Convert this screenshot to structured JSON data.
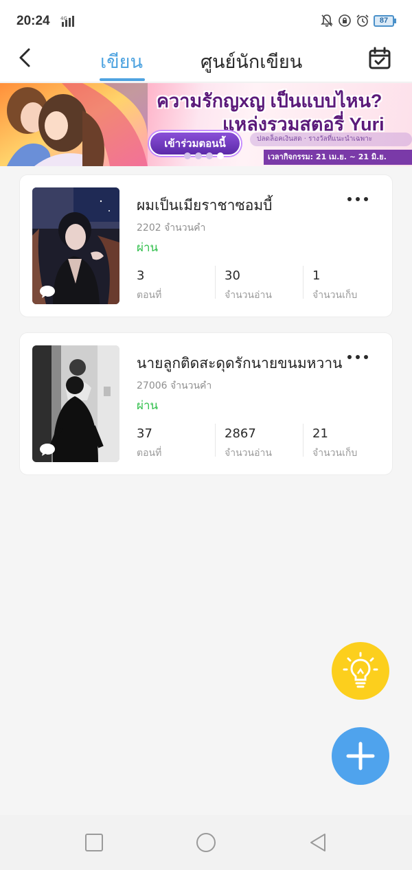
{
  "status_bar": {
    "time": "20:24",
    "network": "4G",
    "battery": "87",
    "icons": [
      "bell-off-icon",
      "lock-rotation-icon",
      "alarm-icon"
    ]
  },
  "header": {
    "back_icon": "chevron-left-icon",
    "tabs": [
      {
        "label": "เขียน",
        "active": true
      },
      {
        "label": "ศูนย์นักเขียน",
        "active": false
      }
    ],
    "calendar_icon": "calendar-check-icon",
    "accent_color": "#4ea3e0"
  },
  "banner": {
    "title_line1": "ความรักญxญ เป็นแบบไหน?",
    "title_line2": "แหล่งรวมสตอรี่ Yuri",
    "join_label": "เข้าร่วมตอนนี้",
    "subtitle": "ปลดล็อคเงินสด · รางวัลที่แนะนำเฉพาะ",
    "date_text": "เวลากิจกรรม: 21 เม.ย. ~ 21 มิ.ย.",
    "dots": 4,
    "active_dot": 3
  },
  "stories": [
    {
      "title": "ผมเป็นเมียราชาซอมบี้",
      "word_count": "2202 จำนวนคำ",
      "status": "ผ่าน",
      "stats": [
        {
          "value": "3",
          "label": "ตอนที่"
        },
        {
          "value": "30",
          "label": "จำนวนอ่าน"
        },
        {
          "value": "1",
          "label": "จำนวนเก็บ"
        }
      ]
    },
    {
      "title": "นายลูกติดสะดุดรักนายขนมหวาน",
      "word_count": "27006 จำนวนคำ",
      "status": "ผ่าน",
      "stats": [
        {
          "value": "37",
          "label": "ตอนที่"
        },
        {
          "value": "2867",
          "label": "จำนวนอ่าน"
        },
        {
          "value": "21",
          "label": "จำนวนเก็บ"
        }
      ]
    }
  ],
  "colors": {
    "status_pass": "#2fbf4a",
    "fab_idea": "#fccf1d",
    "fab_add": "#4fa3ed"
  },
  "fabs": {
    "idea_icon": "lightbulb-icon",
    "add_icon": "plus-icon"
  },
  "nav": {
    "icons": [
      "square-recent-icon",
      "circle-home-icon",
      "triangle-back-icon"
    ]
  }
}
